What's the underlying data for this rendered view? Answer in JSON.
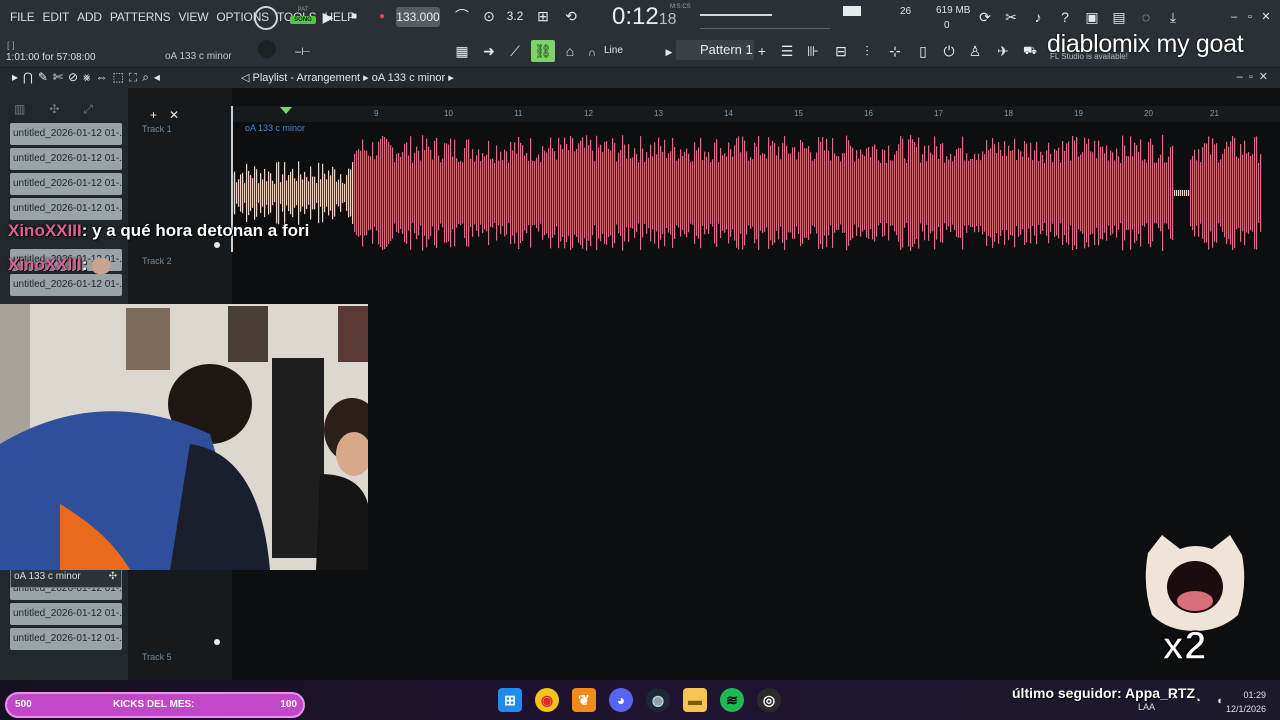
{
  "menu": [
    "FILE",
    "EDIT",
    "ADD",
    "PATTERNS",
    "VIEW",
    "OPTIONS",
    "TOOLS",
    "HELP"
  ],
  "transport": {
    "pat_label": "PAT",
    "song_label": "SONG",
    "tempo": "133.000",
    "time": "0:12",
    "time_frac": "18",
    "time_unit": "M:S:CS"
  },
  "monitor": {
    "cpu": "26",
    "memory": "619 MB",
    "polyphony": "0"
  },
  "hint": {
    "position": "1:01:00 for 57:08:00",
    "brackets": "[    ]",
    "pattern": "oA 133 c minor"
  },
  "snap": "Line",
  "pattern_selector": "Pattern 1",
  "overlay_title": "diablomix my goat",
  "update_note": "FL Studio is available!",
  "playlist": {
    "title_prefix": "Playlist - Arrangement",
    "title_clip": "oA 133 c minor",
    "clip_label": "oA 133 c minor",
    "tracks": [
      "Track 1",
      "Track 2",
      "Track 5"
    ],
    "bar_numbers": [
      "9",
      "10",
      "11",
      "12",
      "13",
      "14",
      "15",
      "16",
      "17",
      "18",
      "19",
      "20",
      "21"
    ]
  },
  "picker": {
    "clips": [
      "untitled_2026-01-12 01-...",
      "untitled_2026-01-12 01-...",
      "untitled_2026-01-12 01-...",
      "untitled_2026-01-12 01-...",
      "untitled_2026-01-12 01-...",
      "untitled_2026-01-12 01-...",
      "untitled_2026-01-12 01-...",
      "untitled_2026-01-12 01-...",
      "untitled_2026-01-12 01-...",
      "untitled_2026-01-12 01-..."
    ],
    "active": "oA 133 c minor"
  },
  "chat": [
    {
      "user": "XinoXXIII",
      "text": ": y a qué hora detonan a fori"
    },
    {
      "user": "XinoXXIII",
      "text": ":"
    }
  ],
  "cat_badge": "x2",
  "bottom": {
    "kicks_left": "500",
    "kicks_label": "KICKS DEL MES:",
    "kicks_right": "100",
    "follower": "último seguidor: Appa_RTZ",
    "lang": "LAA",
    "clock_time": "01:29",
    "clock_date": "12/1/2026"
  },
  "colors": {
    "accent_green": "#7fd36a",
    "waveform": "#d9707f",
    "waveform_light": "#f1d6c8",
    "kicks_bar": "#c247c8",
    "chat_user": "#e0609a"
  }
}
